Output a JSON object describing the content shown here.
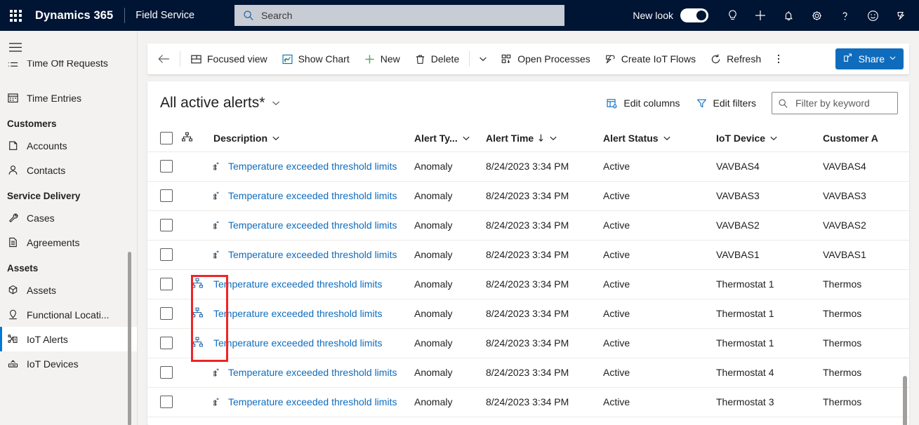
{
  "appbar": {
    "waffle_icon": "waffle-grid-icon",
    "brand": "Dynamics 365",
    "app_name": "Field Service",
    "search": {
      "placeholder": "Search",
      "value": "",
      "icon": "search-icon"
    },
    "new_look_label": "New look",
    "new_look_on": true,
    "icons": [
      {
        "name": "lightbulb-icon",
        "glyph": "lightbulb"
      },
      {
        "name": "plus-icon",
        "glyph": "plus"
      },
      {
        "name": "bell-icon",
        "glyph": "bell"
      },
      {
        "name": "gear-icon",
        "glyph": "gear"
      },
      {
        "name": "help-icon",
        "glyph": "question"
      },
      {
        "name": "smiley-icon",
        "glyph": "smiley"
      },
      {
        "name": "copilot-icon",
        "glyph": "copilot"
      }
    ]
  },
  "sidebar": {
    "hamburger_icon": "hamburger-icon",
    "clipped_item": {
      "label": "Time Off Requests",
      "icon": "list-icon"
    },
    "entries": [
      {
        "type": "item",
        "label": "Time Entries",
        "icon": "calendar-icon",
        "selected": false
      },
      {
        "type": "group",
        "label": "Customers"
      },
      {
        "type": "item",
        "label": "Accounts",
        "icon": "account-icon",
        "selected": false
      },
      {
        "type": "item",
        "label": "Contacts",
        "icon": "contact-icon",
        "selected": false
      },
      {
        "type": "group",
        "label": "Service Delivery"
      },
      {
        "type": "item",
        "label": "Cases",
        "icon": "wrench-icon",
        "selected": false
      },
      {
        "type": "item",
        "label": "Agreements",
        "icon": "document-icon",
        "selected": false
      },
      {
        "type": "group",
        "label": "Assets"
      },
      {
        "type": "item",
        "label": "Assets",
        "icon": "cube-icon",
        "selected": false
      },
      {
        "type": "item",
        "label": "Functional Locati...",
        "icon": "location-icon",
        "selected": false
      },
      {
        "type": "item",
        "label": "IoT Alerts",
        "icon": "iot-alert-icon",
        "selected": true
      },
      {
        "type": "item",
        "label": "IoT Devices",
        "icon": "iot-device-icon",
        "selected": false
      }
    ]
  },
  "commandbar": {
    "back_icon": "back-arrow-icon",
    "buttons": [
      {
        "label": "Focused view",
        "icon": "focused-view-icon"
      },
      {
        "label": "Show Chart",
        "icon": "chart-icon"
      },
      {
        "label": "New",
        "icon": "plus-icon"
      },
      {
        "label": "Delete",
        "icon": "trash-icon"
      }
    ],
    "overflow_chevron_icon": "chevron-down-icon",
    "buttons2": [
      {
        "label": "Open Processes",
        "icon": "open-processes-icon"
      },
      {
        "label": "Create IoT Flows",
        "icon": "iot-flows-icon"
      },
      {
        "label": "Refresh",
        "icon": "refresh-icon"
      }
    ],
    "more_icon": "more-vertical-icon",
    "share": {
      "label": "Share",
      "icon": "share-icon",
      "chevron": "chevron-down-icon",
      "color": "#0f6cbd"
    }
  },
  "view": {
    "title": "All active alerts*",
    "title_chevron_icon": "chevron-down-icon",
    "edit_columns": {
      "label": "Edit columns",
      "icon": "edit-columns-icon"
    },
    "edit_filters": {
      "label": "Edit filters",
      "icon": "filter-icon"
    },
    "keyword_filter": {
      "placeholder": "Filter by keyword",
      "value": "",
      "icon": "search-icon"
    }
  },
  "table": {
    "select_all_checkbox": false,
    "hierarchy_header_icon": "hierarchy-icon",
    "columns": [
      {
        "key": "description",
        "label": "Description",
        "chevron": true,
        "sorted": false
      },
      {
        "key": "alert_type",
        "label": "Alert Ty...",
        "chevron": true,
        "sorted": false
      },
      {
        "key": "alert_time",
        "label": "Alert Time",
        "chevron": true,
        "sorted": true,
        "sort_dir": "desc"
      },
      {
        "key": "alert_status",
        "label": "Alert Status",
        "chevron": true,
        "sorted": false
      },
      {
        "key": "iot_device",
        "label": "IoT Device",
        "chevron": true,
        "sorted": false
      },
      {
        "key": "customer_asset",
        "label": "Customer A",
        "chevron": false,
        "sorted": false
      }
    ],
    "rows": [
      {
        "checked": false,
        "hier_badge": false,
        "desc_icon": true,
        "description": "Temperature exceeded threshold limits",
        "alert_type": "Anomaly",
        "alert_time": "8/24/2023 3:34 PM",
        "alert_status": "Active",
        "iot_device": "VAVBAS4",
        "customer_asset": "VAVBAS4"
      },
      {
        "checked": false,
        "hier_badge": false,
        "desc_icon": true,
        "description": "Temperature exceeded threshold limits",
        "alert_type": "Anomaly",
        "alert_time": "8/24/2023 3:34 PM",
        "alert_status": "Active",
        "iot_device": "VAVBAS3",
        "customer_asset": "VAVBAS3"
      },
      {
        "checked": false,
        "hier_badge": false,
        "desc_icon": true,
        "description": "Temperature exceeded threshold limits",
        "alert_type": "Anomaly",
        "alert_time": "8/24/2023 3:34 PM",
        "alert_status": "Active",
        "iot_device": "VAVBAS2",
        "customer_asset": "VAVBAS2"
      },
      {
        "checked": false,
        "hier_badge": false,
        "desc_icon": true,
        "description": "Temperature exceeded threshold limits",
        "alert_type": "Anomaly",
        "alert_time": "8/24/2023 3:34 PM",
        "alert_status": "Active",
        "iot_device": "VAVBAS1",
        "customer_asset": "VAVBAS1"
      },
      {
        "checked": false,
        "hier_badge": true,
        "desc_icon": false,
        "description": "Temperature exceeded threshold limits",
        "alert_type": "Anomaly",
        "alert_time": "8/24/2023 3:34 PM",
        "alert_status": "Active",
        "iot_device": "Thermostat 1",
        "customer_asset": "Thermos"
      },
      {
        "checked": false,
        "hier_badge": true,
        "desc_icon": false,
        "description": "Temperature exceeded threshold limits",
        "alert_type": "Anomaly",
        "alert_time": "8/24/2023 3:34 PM",
        "alert_status": "Active",
        "iot_device": "Thermostat 1",
        "customer_asset": "Thermos"
      },
      {
        "checked": false,
        "hier_badge": true,
        "desc_icon": false,
        "description": "Temperature exceeded threshold limits",
        "alert_type": "Anomaly",
        "alert_time": "8/24/2023 3:34 PM",
        "alert_status": "Active",
        "iot_device": "Thermostat 1",
        "customer_asset": "Thermos"
      },
      {
        "checked": false,
        "hier_badge": false,
        "desc_icon": true,
        "description": "Temperature exceeded threshold limits",
        "alert_type": "Anomaly",
        "alert_time": "8/24/2023 3:34 PM",
        "alert_status": "Active",
        "iot_device": "Thermostat 4",
        "customer_asset": "Thermos"
      },
      {
        "checked": false,
        "hier_badge": false,
        "desc_icon": true,
        "description": "Temperature exceeded threshold limits",
        "alert_type": "Anomaly",
        "alert_time": "8/24/2023 3:34 PM",
        "alert_status": "Active",
        "iot_device": "Thermostat 3",
        "customer_asset": "Thermos"
      }
    ]
  },
  "annotation": {
    "name": "highlight-box",
    "color": "#ef2424"
  },
  "colors": {
    "brand_dark": "#001433",
    "accent": "#0f6cbd",
    "link": "#0f6cbd",
    "surface": "#f3f2f1",
    "highlight": "#ef2424"
  }
}
